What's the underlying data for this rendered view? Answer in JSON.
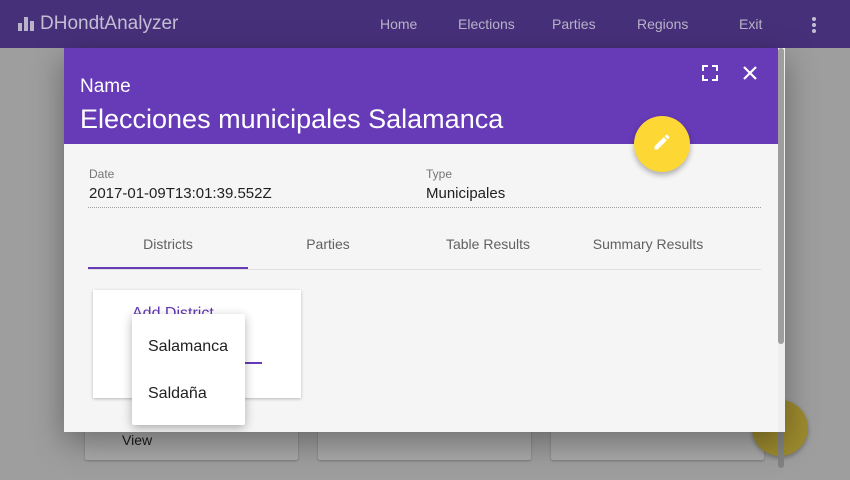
{
  "app": {
    "title": "DHondtAnalyzer",
    "nav": [
      "Home",
      "Elections",
      "Parties",
      "Regions",
      "Exit"
    ]
  },
  "background": {
    "view_label": "View"
  },
  "dialog": {
    "name_label": "Name",
    "name_value": "Elecciones municipales Salamanca",
    "date_label": "Date",
    "date_value": "2017-01-09T13:01:39.552Z",
    "type_label": "Type",
    "type_value": "Municipales",
    "tabs": [
      "Districts",
      "Parties",
      "Table Results",
      "Summary Results"
    ],
    "active_tab": "Districts",
    "add_district_label": "Add District",
    "dropdown_options": [
      "Salamanca",
      "Saldaña"
    ]
  },
  "colors": {
    "primary": "#673ab7",
    "accent": "#fdd835",
    "appbar_dimmed": "#47307a"
  },
  "icons": [
    "bar-chart-icon",
    "more-vert-icon",
    "fullscreen-icon",
    "close-icon",
    "edit-icon"
  ]
}
